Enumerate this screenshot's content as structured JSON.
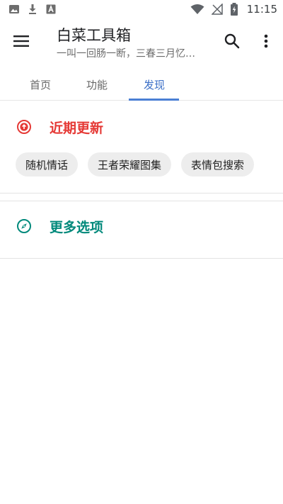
{
  "status_bar": {
    "time": "11:15",
    "left_icons": [
      "image-icon",
      "download-icon",
      "font-icon"
    ],
    "right_icons": [
      "wifi-icon",
      "no-signal-icon",
      "battery-charging-icon"
    ]
  },
  "app_bar": {
    "title": "白菜工具箱",
    "subtitle": "一叫一回肠一断，三春三月忆…",
    "menu_icon": "menu-icon",
    "search_icon": "search-icon",
    "more_icon": "more-vert-icon"
  },
  "tabs": [
    {
      "label": "首页",
      "active": false
    },
    {
      "label": "功能",
      "active": false
    },
    {
      "label": "发现",
      "active": true
    }
  ],
  "sections": {
    "recent": {
      "title": "近期更新",
      "icon": "arrow-up-circle-icon",
      "color": "#e53935",
      "chips": [
        "随机情话",
        "王者荣耀图集",
        "表情包搜索"
      ]
    },
    "more": {
      "title": "更多选项",
      "icon": "compass-icon",
      "color": "#00897b"
    }
  },
  "colors": {
    "accent": "#3b6fc7",
    "chip_bg": "#ededed"
  }
}
